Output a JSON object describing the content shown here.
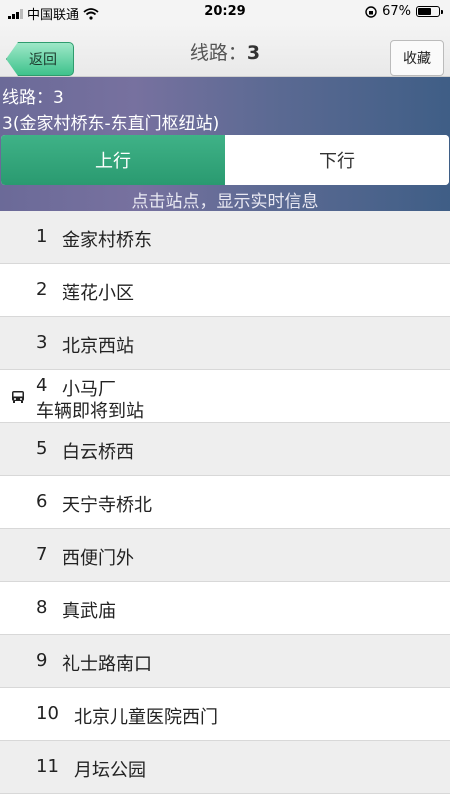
{
  "status": {
    "carrier": "中国联通",
    "time": "20:29",
    "battery_pct": "67%",
    "battery_level": 0.67
  },
  "nav": {
    "back_label": "返回",
    "title_prefix": "线路：",
    "title_value": "3",
    "fav_label": "收藏"
  },
  "route": {
    "name": "线路：3",
    "full": "3(金家村桥东-东直门枢纽站)",
    "dir_up": "上行",
    "dir_down": "下行",
    "hint": "点击站点，显示实时信息"
  },
  "stops": [
    {
      "num": "1",
      "name": "金家村桥东"
    },
    {
      "num": "2",
      "name": "莲花小区"
    },
    {
      "num": "3",
      "name": "北京西站"
    },
    {
      "num": "4",
      "name": "小马厂",
      "bus_note": "车辆即将到站"
    },
    {
      "num": "5",
      "name": "白云桥西"
    },
    {
      "num": "6",
      "name": "天宁寺桥北"
    },
    {
      "num": "7",
      "name": "西便门外"
    },
    {
      "num": "8",
      "name": "真武庙"
    },
    {
      "num": "9",
      "name": "礼士路南口"
    },
    {
      "num": "10",
      "name": "北京儿童医院西门"
    },
    {
      "num": "11",
      "name": "月坛公园"
    }
  ]
}
